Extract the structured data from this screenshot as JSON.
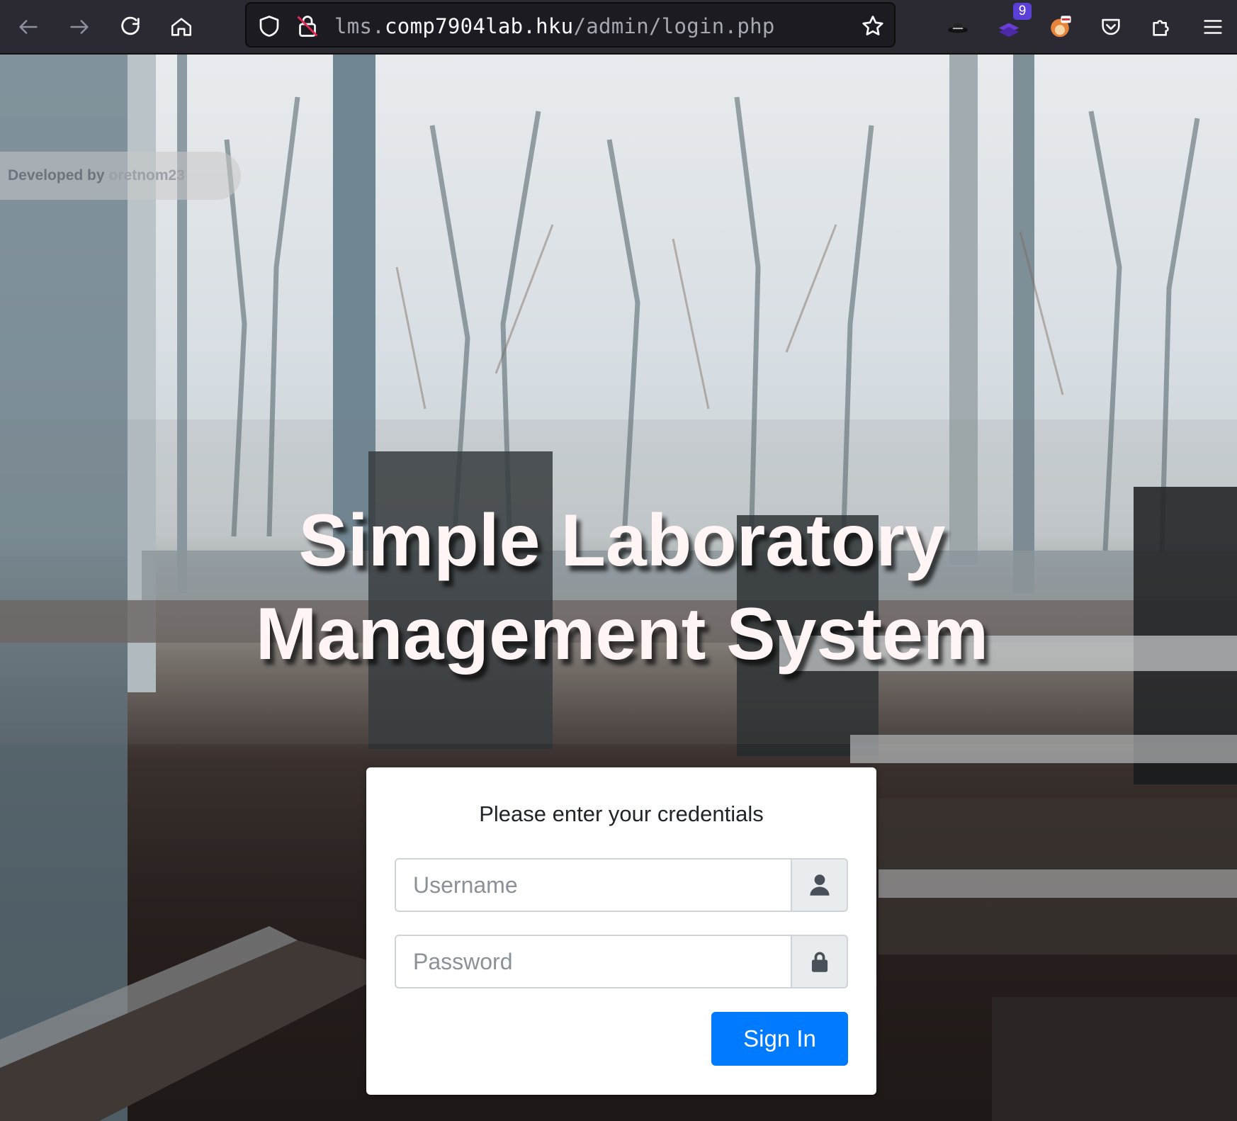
{
  "browser": {
    "url_prefix": "lms.",
    "url_host": "comp7904lab.hku",
    "url_path": "/admin/login.php",
    "extension_badge": "9"
  },
  "page": {
    "developer_prefix": "Developed by",
    "developer_name": "oretnom23",
    "title_line1": "Simple Laboratory",
    "title_line2": "Management System"
  },
  "login": {
    "message": "Please enter your credentials",
    "username_placeholder": "Username",
    "password_placeholder": "Password",
    "signin_label": "Sign In"
  },
  "colors": {
    "primary": "#007bff",
    "toolbar": "#2b2a33",
    "title_text": "#fff5f5"
  }
}
